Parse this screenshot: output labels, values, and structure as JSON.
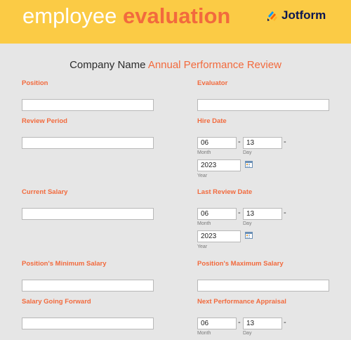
{
  "header": {
    "title_plain": "employee ",
    "title_accent": "evaluation",
    "brand": "Jotform"
  },
  "form": {
    "heading_plain": "Company Name ",
    "heading_accent": "Annual Performance Review"
  },
  "fields": {
    "position": {
      "label": "Position",
      "value": ""
    },
    "evaluator": {
      "label": "Evaluator",
      "value": ""
    },
    "review_period": {
      "label": "Review Period",
      "value": ""
    },
    "hire_date": {
      "label": "Hire Date",
      "month": "06",
      "day": "13",
      "year": "2023"
    },
    "current_salary": {
      "label": "Current Salary",
      "value": ""
    },
    "last_review_date": {
      "label": "Last Review Date",
      "month": "06",
      "day": "13",
      "year": "2023"
    },
    "min_salary": {
      "label": "Position's Minimum Salary",
      "value": ""
    },
    "max_salary": {
      "label": "Position's Maximum Salary",
      "value": ""
    },
    "salary_forward": {
      "label": "Salary Going Forward",
      "value": ""
    },
    "next_appraisal": {
      "label": "Next Performance Appraisal",
      "month": "06",
      "day": "13"
    }
  },
  "date_parts": {
    "month": "Month",
    "day": "Day",
    "year": "Year",
    "separator": "-"
  },
  "icons": {
    "calendar": "calendar-icon",
    "brand": "jotform-logo-icon"
  },
  "colors": {
    "header_bg": "#fbcb45",
    "accent": "#f26a3d",
    "page_bg": "#e6e6e6"
  }
}
